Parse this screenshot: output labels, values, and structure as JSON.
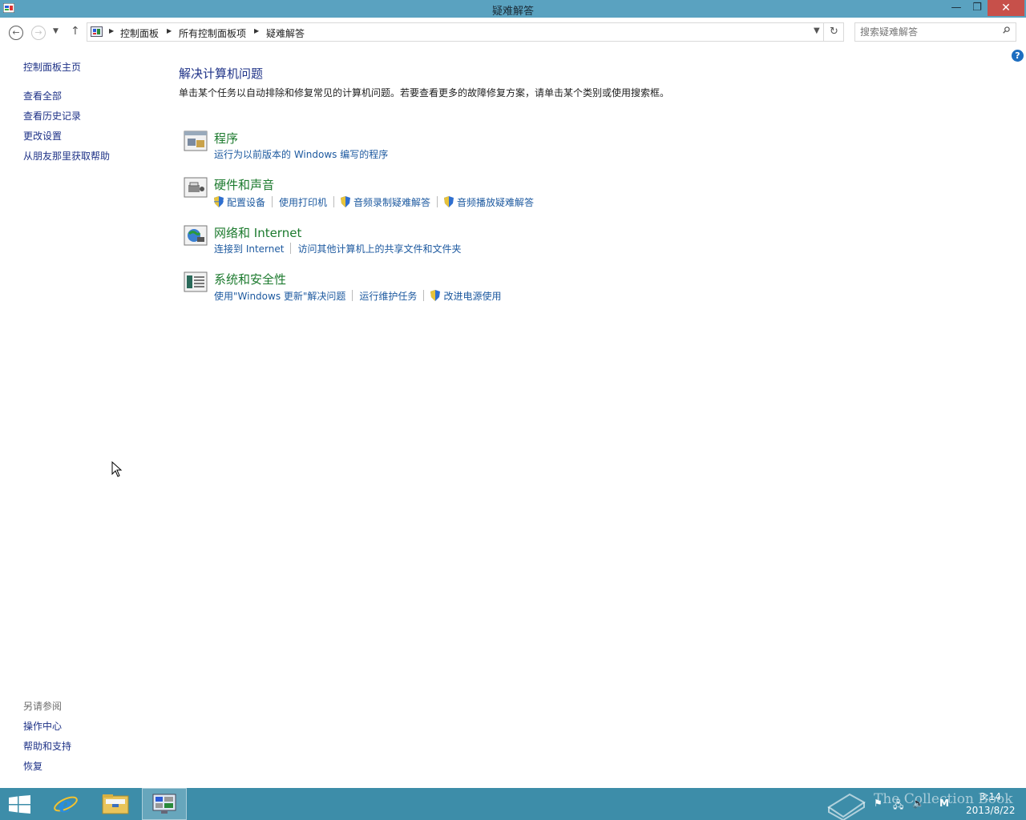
{
  "window": {
    "title": "疑难解答",
    "minimize": "—",
    "maximize": "❐",
    "close": "✕"
  },
  "address": {
    "crumbs": [
      "控制面板",
      "所有控制面板项",
      "疑难解答"
    ]
  },
  "search": {
    "placeholder": "搜索疑难解答"
  },
  "help": "?",
  "left_pane": {
    "links": [
      "控制面板主页",
      "查看全部",
      "查看历史记录",
      "更改设置",
      "从朋友那里获取帮助"
    ],
    "see_also_title": "另请参阅",
    "see_also": [
      "操作中心",
      "帮助和支持",
      "恢复"
    ]
  },
  "main": {
    "title": "解决计算机问题",
    "description": "单击某个任务以自动排除和修复常见的计算机问题。若要查看更多的故障修复方案，请单击某个类别或使用搜索框。",
    "categories": [
      {
        "title": "程序",
        "links": [
          "运行为以前版本的 Windows 编写的程序"
        ]
      },
      {
        "title": "硬件和声音",
        "links": [
          "配置设备",
          "使用打印机",
          "音频录制疑难解答",
          "音频播放疑难解答"
        ]
      },
      {
        "title": "网络和 Internet",
        "links": [
          "连接到 Internet",
          "访问其他计算机上的共享文件和文件夹"
        ]
      },
      {
        "title": "系统和安全性",
        "links": [
          "使用\"Windows 更新\"解决问题",
          "运行维护任务",
          "改进电源使用"
        ]
      }
    ]
  },
  "taskbar": {
    "watermark": "The Collection Book",
    "time": "3:14",
    "date": "2013/8/22",
    "ime": "M"
  },
  "colors": {
    "titlebar": "#5aa2c0",
    "taskbar": "#3d8da9",
    "link": "#1e5aa0",
    "category": "#1c7a2e"
  }
}
